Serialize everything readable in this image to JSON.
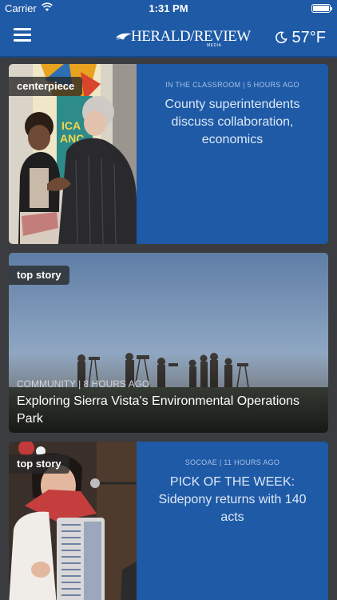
{
  "status_bar": {
    "carrier": "Carrier",
    "time": "1:31 PM",
    "wifi_icon": "wifi-icon",
    "battery_icon": "battery-icon"
  },
  "nav": {
    "menu_icon": "hamburger-icon",
    "logo_text": "HERALD/REVIEW",
    "logo_subtext": "MEDIA",
    "weather_icon": "moon-icon",
    "temperature": "57°F"
  },
  "colors": {
    "brand_blue": "#1e5aa6",
    "tag_background": "#2a2a2a",
    "page_background": "#3a3c40"
  },
  "stories": [
    {
      "tag": "centerpiece",
      "meta": "IN THE CLASSROOM | 5 HOURS AGO",
      "headline": "County superintendents discuss collaboration, economics",
      "layout": "split"
    },
    {
      "tag": "top story",
      "meta": "COMMUNITY | 8 HOURS AGO",
      "headline": "Exploring Sierra Vista's Environmental Operations Park",
      "layout": "full"
    },
    {
      "tag": "top story",
      "meta": "SOCOAE | 11 HOURS AGO",
      "headline": "PICK OF THE WEEK: Sidepony returns with 140 acts",
      "layout": "split"
    }
  ]
}
